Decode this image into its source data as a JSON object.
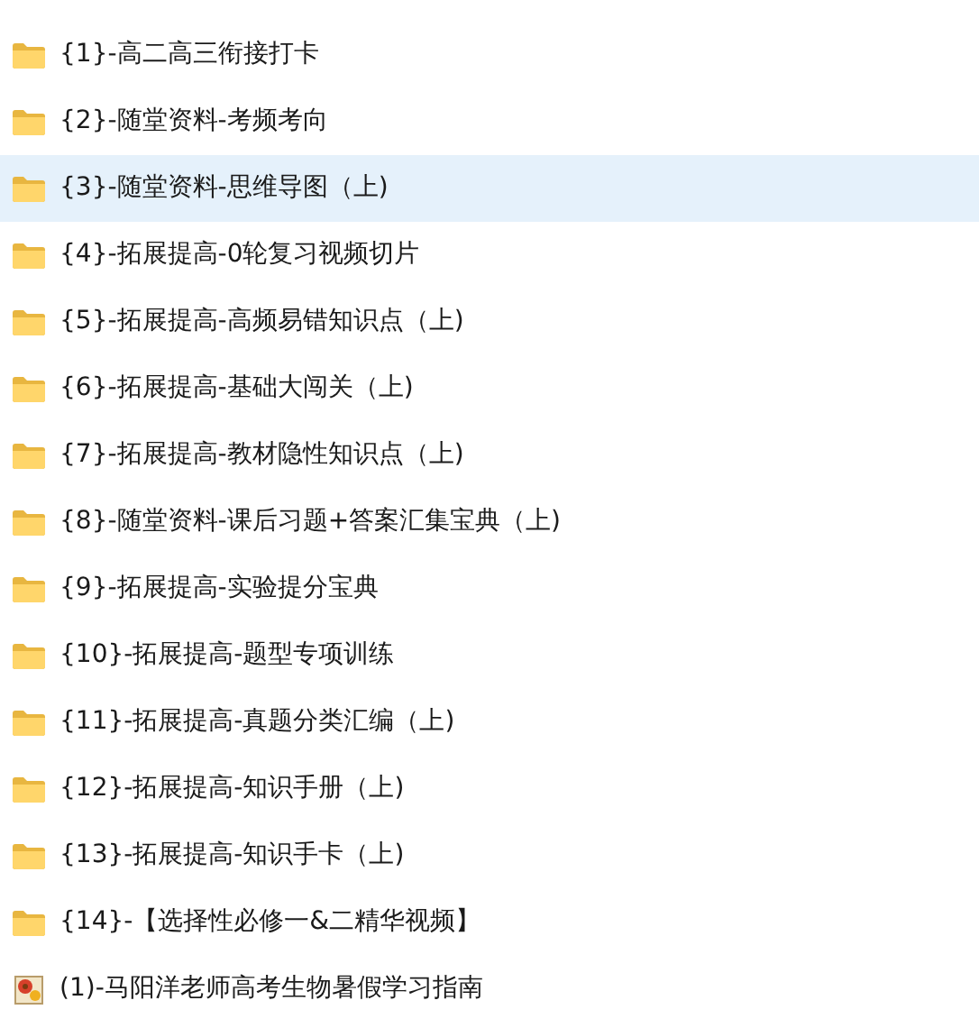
{
  "items": [
    {
      "kind": "folder",
      "name": "{1}-高二高三衔接打卡",
      "selected": false
    },
    {
      "kind": "folder",
      "name": "{2}-随堂资料-考频考向",
      "selected": false
    },
    {
      "kind": "folder",
      "name": "{3}-随堂资料-思维导图（上)",
      "selected": true
    },
    {
      "kind": "folder",
      "name": "{4}-拓展提高-0轮复习视频切片",
      "selected": false
    },
    {
      "kind": "folder",
      "name": "{5}-拓展提高-高频易错知识点（上)",
      "selected": false
    },
    {
      "kind": "folder",
      "name": "{6}-拓展提高-基础大闯关（上)",
      "selected": false
    },
    {
      "kind": "folder",
      "name": "{7}-拓展提高-教材隐性知识点（上)",
      "selected": false
    },
    {
      "kind": "folder",
      "name": "{8}-随堂资料-课后习题+答案汇集宝典（上)",
      "selected": false
    },
    {
      "kind": "folder",
      "name": "{9}-拓展提高-实验提分宝典",
      "selected": false
    },
    {
      "kind": "folder",
      "name": "{10}-拓展提高-题型专项训练",
      "selected": false
    },
    {
      "kind": "folder",
      "name": "{11}-拓展提高-真题分类汇编（上)",
      "selected": false
    },
    {
      "kind": "folder",
      "name": "{12}-拓展提高-知识手册（上)",
      "selected": false
    },
    {
      "kind": "folder",
      "name": "{13}-拓展提高-知识手卡（上)",
      "selected": false
    },
    {
      "kind": "folder",
      "name": "{14}-【选择性必修一&二精华视频】",
      "selected": false
    },
    {
      "kind": "image",
      "name": "(1)-马阳洋老师高考生物暑假学习指南",
      "selected": false
    }
  ]
}
